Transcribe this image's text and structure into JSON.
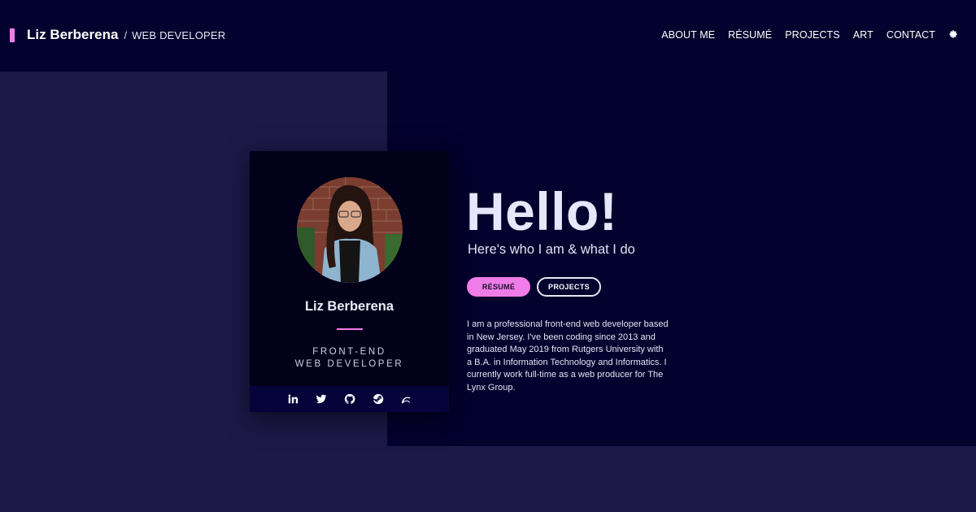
{
  "header": {
    "name": "Liz Berberena",
    "separator": "/",
    "role": "WEB DEVELOPER",
    "nav": [
      "ABOUT ME",
      "RÉSUMÉ",
      "PROJECTS",
      "ART",
      "CONTACT"
    ],
    "settings_icon": "gear-icon"
  },
  "card": {
    "name": "Liz Berberena",
    "role_line1": "FRONT-END",
    "role_line2": "WEB DEVELOPER",
    "social_icons": [
      "linkedin-icon",
      "twitter-icon",
      "github-icon",
      "steam-icon",
      "deviantart-icon"
    ]
  },
  "intro": {
    "heading": "Hello!",
    "tagline": "Here's who I am & what I do",
    "buttons": {
      "resume": "RÉSUMÉ",
      "projects": "PROJECTS"
    },
    "bio": "I am a professional front-end web developer based in New Jersey. I've been coding since 2013 and graduated May 2019 from Rutgers University with a B.A. in Information Technology and Informatics. I currently work full-time as a web producer for The Lynx Group."
  },
  "colors": {
    "accent": "#f07ce8",
    "background": "#1c1848",
    "panel": "#03012d",
    "card": "#03001a"
  }
}
